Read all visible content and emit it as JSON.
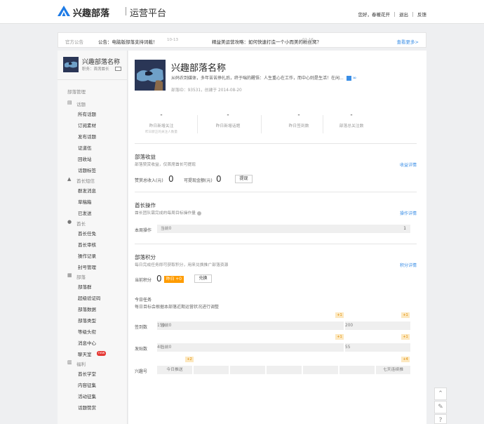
{
  "header": {
    "brand": "兴趣部落",
    "platform": "运营平台",
    "greeting": "您好，春暖花开",
    "logout": "退出",
    "feedback": "反馈"
  },
  "notice": {
    "label": "官方公告",
    "items": [
      {
        "text": "公告：电脑版部落支持词截！",
        "date": "10-13"
      },
      {
        "text": "精益美运营攻略：如何快速打造一个小而美的粉丝窝？",
        "date": "01-16"
      }
    ],
    "more": "查看更多>"
  },
  "sidebar": {
    "tribe_name": "兴趣部落名称",
    "role": "职务：首席酋长",
    "title": "部落管理",
    "groups": [
      {
        "label": "话题",
        "icon": "document-icon",
        "items": [
          "所有话题",
          "订阅素材",
          "发布话题",
          "证道伍",
          "回收站",
          "话题标签"
        ]
      },
      {
        "label": "酋长短信",
        "icon": "warning-icon",
        "items": [
          "群发消息",
          "草稿箱",
          "已发送"
        ]
      },
      {
        "label": "酋长",
        "icon": "user-icon",
        "items": [
          "酋长任免",
          "酋长审核",
          "操作记录",
          "封号管理"
        ]
      },
      {
        "label": "部落",
        "icon": "building-icon",
        "items": [
          "部落群",
          "超级验证码",
          "部落数据",
          "部落类型",
          "等级头衔",
          "消息中心",
          "聊天室"
        ]
      },
      {
        "label": "福利",
        "icon": "chart-icon",
        "items": [
          "酋长学堂",
          "内容征集",
          "活动征集",
          "话题赞赏"
        ]
      }
    ],
    "new_badge": "new"
  },
  "profile": {
    "name": "兴趣部落名称",
    "desc": "从码农到媒体，多年苦苦挣扎后，终于喘的醒悟：人生重心在工作，而中心则是生活！在闲...",
    "meta": "部落ID：93531，创建于 2014-08-20"
  },
  "stats": [
    {
      "value": "-",
      "label": "昨日新增关注",
      "sub": "昨日新正的关注人数量"
    },
    {
      "value": "-",
      "label": "昨日新增话题",
      "sub": ""
    },
    {
      "value": "-",
      "label": "昨日签到数",
      "sub": ""
    },
    {
      "value": "-",
      "label": "部落总关注数",
      "sub": ""
    }
  ],
  "revenue": {
    "title": "部落收益",
    "sub": "部落赞赏收益，仅首席酋长可提现",
    "link": "收益详情",
    "total_label": "赞赏总收入(元)",
    "total_value": "0",
    "cash_label": "可提现金额(元)",
    "cash_value": "0",
    "withdraw": "提现"
  },
  "chief_ops": {
    "title": "酋长操作",
    "sub": "酋长团队需完成的每周目标操作量",
    "link": "操作详情",
    "row_label": "本周操作",
    "current": "当前0",
    "target": "1"
  },
  "points": {
    "title": "部落积分",
    "sub": "每日完成任务即可获取积分，用来兑换推广部落资源",
    "link": "积分详情",
    "label": "当前积分",
    "value": "0",
    "today_badge": "昨日 +0",
    "exchange": "兑换"
  },
  "tasks": {
    "title": "今日任务",
    "sub": "每日目标会根据本部落近期运营状况进行调整",
    "rows": [
      {
        "label": "签到数",
        "current": "当前0",
        "goal1": "150",
        "goal2": "200",
        "plus1": "+1",
        "plus2": "+1"
      },
      {
        "label": "发贴数",
        "current": "当前0",
        "goal1": "40",
        "goal2": "55",
        "plus1": "+1",
        "plus2": "+1"
      }
    ],
    "streak": {
      "label": "兴趣号",
      "today": "今日推送",
      "seven": "七天连续推",
      "plus1": "+2",
      "plus2": "+4"
    }
  }
}
